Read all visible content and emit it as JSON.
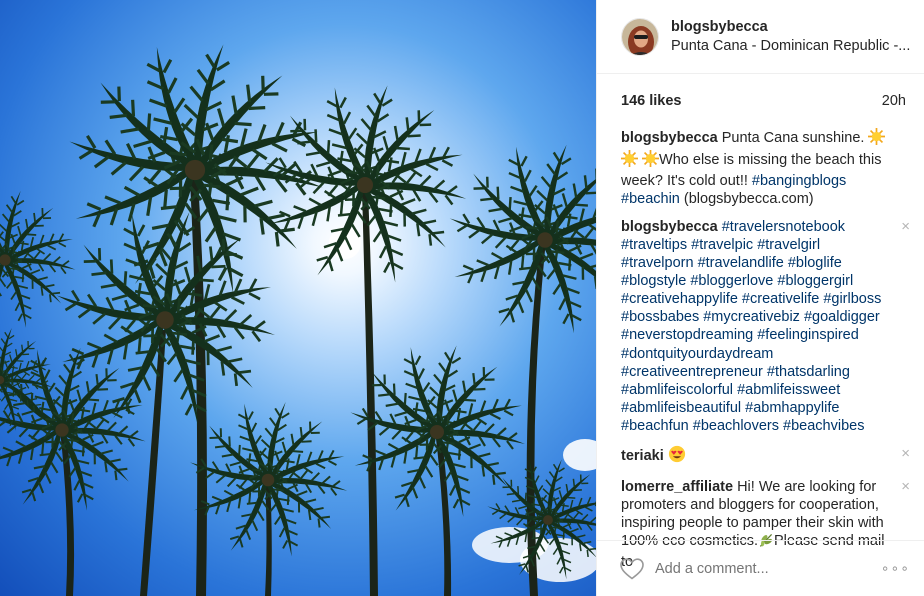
{
  "post": {
    "username": "blogsbybecca",
    "location": "Punta Cana - Dominican Republic -...",
    "likes": "146 likes",
    "time": "20h"
  },
  "caption": {
    "author": "blogsbybecca",
    "text_1": "Punta Cana sunshine.",
    "text_2": "Who else is missing the beach this week? It's cold out!!",
    "tag_1": "#bangingblogs",
    "tag_2": "#beachin",
    "text_3": "(blogsbybecca.com)"
  },
  "hashtag_comment": {
    "author": "blogsbybecca",
    "tags": [
      "#travelersnotebook",
      "#traveltips",
      "#travelpic",
      "#travelgirl",
      "#travelporn",
      "#travelandlife",
      "#bloglife",
      "#blogstyle",
      "#bloggerlove",
      "#bloggergirl",
      "#creativehappylife",
      "#creativelife",
      "#girlboss",
      "#bossbabes",
      "#mycreativebiz",
      "#goaldigger",
      "#neverstopdreaming",
      "#feelinginspired",
      "#dontquityourdaydream",
      "#creativeentrepreneur",
      "#thatsdarling",
      "#abmlifeiscolorful",
      "#abmlifeissweet",
      "#abmlifeisbeautiful",
      "#abmhappylife",
      "#beachfun",
      "#beachlovers",
      "#beachvibes"
    ]
  },
  "comment_teriaki": {
    "author": "teriaki"
  },
  "comment_lomerre": {
    "author": "lomerre_affiliate",
    "text_1": "Hi! We are looking for promoters and bloggers for cooperation, inspiring people to pamper their skin with 100% eco cosmetics.",
    "text_2": "Please send mail to"
  },
  "footer": {
    "placeholder": "Add a comment...",
    "more": "∘∘∘"
  },
  "icons": {
    "close": "×",
    "heart": "heart-outline-icon",
    "sun_emoji": "sun-emoji",
    "heart_eyes_emoji": "heart-eyes-emoji",
    "leaf_emoji": "herb-emoji"
  },
  "colors": {
    "hashtag": "#003569",
    "sky_top": "#0d47b8",
    "sky_sun": "#e9f4ff",
    "muted": "#999999"
  }
}
